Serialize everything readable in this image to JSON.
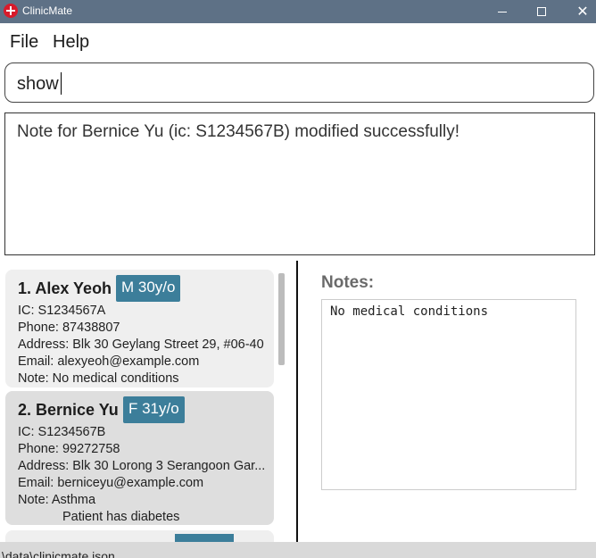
{
  "window": {
    "title": "ClinicMate",
    "app_icon": "medical-cross-icon",
    "min_icon": "minimize-icon",
    "max_icon": "maximize-icon",
    "close_glyph": "✕"
  },
  "menu": {
    "file": "File",
    "help": "Help"
  },
  "command": {
    "value": "show"
  },
  "result": {
    "message": "Note for Bernice Yu (ic: S1234567B) modified successfully!"
  },
  "patients": [
    {
      "index_name": "1.  Alex Yeoh",
      "badge": "M 30y/o",
      "ic": "IC: S1234567A",
      "phone": "Phone: 87438807",
      "address": "Address: Blk 30 Geylang Street 29, #06-40",
      "email": "Email: alexyeoh@example.com",
      "note": "Note: No medical conditions"
    },
    {
      "index_name": "2.  Bernice Yu",
      "badge": "F 31y/o",
      "ic": "IC: S1234567B",
      "phone": "Phone: 99272758",
      "address": "Address: Blk 30 Lorong 3 Serangoon Gar...",
      "email": "Email: berniceyu@example.com",
      "note": "Note: Asthma",
      "note_line2": "Patient has diabetes"
    }
  ],
  "notes": {
    "label": "Notes:",
    "content": "No medical conditions"
  },
  "status": {
    "path": "\\data\\clinicmate.json"
  },
  "colors": {
    "titlebar": "#5e7186",
    "badge": "#3c7e9a",
    "selected_card": "#dedede",
    "card": "#efefef"
  }
}
